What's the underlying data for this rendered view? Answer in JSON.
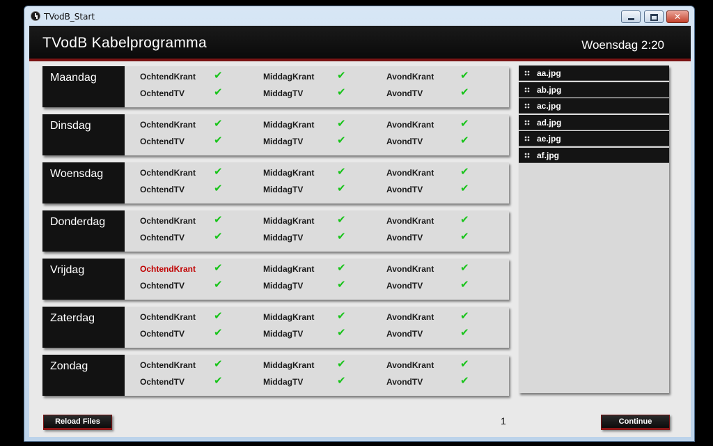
{
  "window": {
    "title": "TVodB_Start",
    "close_glyph": "✕"
  },
  "header": {
    "title": "TVodB Kabelprogramma",
    "clock": "Woensdag 2:20"
  },
  "check_glyph": "✔",
  "days": [
    {
      "label": "Maandag",
      "items": [
        [
          "OchtendKrant",
          "MiddagKrant",
          "AvondKrant"
        ],
        [
          "OchtendTV",
          "MiddagTV",
          "AvondTV"
        ]
      ]
    },
    {
      "label": "Dinsdag",
      "items": [
        [
          "OchtendKrant",
          "MiddagKrant",
          "AvondKrant"
        ],
        [
          "OchtendTV",
          "MiddagTV",
          "AvondTV"
        ]
      ]
    },
    {
      "label": "Woensdag",
      "items": [
        [
          "OchtendKrant",
          "MiddagKrant",
          "AvondKrant"
        ],
        [
          "OchtendTV",
          "MiddagTV",
          "AvondTV"
        ]
      ]
    },
    {
      "label": "Donderdag",
      "items": [
        [
          "OchtendKrant",
          "MiddagKrant",
          "AvondKrant"
        ],
        [
          "OchtendTV",
          "MiddagTV",
          "AvondTV"
        ]
      ]
    },
    {
      "label": "Vrijdag",
      "items": [
        [
          "OchtendKrant",
          "MiddagKrant",
          "AvondKrant"
        ],
        [
          "OchtendTV",
          "MiddagTV",
          "AvondTV"
        ]
      ]
    },
    {
      "label": "Zaterdag",
      "items": [
        [
          "OchtendKrant",
          "MiddagKrant",
          "AvondKrant"
        ],
        [
          "OchtendTV",
          "MiddagTV",
          "AvondTV"
        ]
      ]
    },
    {
      "label": "Zondag",
      "items": [
        [
          "OchtendKrant",
          "MiddagKrant",
          "AvondKrant"
        ],
        [
          "OchtendTV",
          "MiddagTV",
          "AvondTV"
        ]
      ]
    }
  ],
  "files": [
    "aa.jpg",
    "ab.jpg",
    "ac.jpg",
    "ad.jpg",
    "ae.jpg",
    "af.jpg"
  ],
  "buttons": {
    "reload": "Reload Files",
    "continue": "Continue"
  },
  "page_number": "1",
  "colors": {
    "check": "#18c41a",
    "error_text": "#c00000",
    "accent_red": "#7a1414"
  }
}
